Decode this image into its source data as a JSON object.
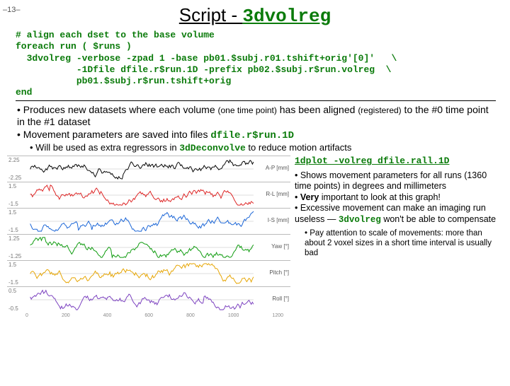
{
  "page_number": "–13–",
  "title": {
    "prefix": "Script - ",
    "cmd": "3dvolreg"
  },
  "code_block": "# align each dset to the base volume\nforeach run ( $runs )\n  3dvolreg -verbose -zpad 1 -base pb01.$subj.r01.tshift+orig'[0]'   \\\n           -1Dfile dfile.r$run.1D -prefix pb02.$subj.r$run.volreg  \\\n           pb01.$subj.r$run.tshift+orig\nend",
  "bullets": {
    "b1_a": "• Produces new datasets where each volume ",
    "b1_paren1": "(one time point)",
    "b1_b": " has been aligned ",
    "b1_paren2": "(registered)",
    "b1_c": " to the #0 time point in the #1 dataset",
    "b2": "• Movement parameters are saved into files ",
    "b2_code": "dfile.r$run.1D",
    "b3_a": "• Will be used as extra regressors in ",
    "b3_code": "3dDeconvolve",
    "b3_b": " to reduce motion artifacts"
  },
  "plot_cmd": "1dplot -volreg dfile.rall.1D",
  "side": {
    "s1": "• Shows movement parameters for all runs (1360 time points) in degrees and millimeters",
    "s2_a": "• ",
    "s2_bold": "Very",
    "s2_b": " important to look at this graph!",
    "s3_a": "• Excessive movement can make an imaging run useless — ",
    "s3_code": "3dvolreg",
    "s3_b": " won't be able to compensate",
    "s4": "• Pay attention to scale of movements: more than about 2 voxel sizes in a short time interval is usually bad"
  },
  "chart_data": [
    {
      "type": "line",
      "label": "A-P [mm]",
      "ylim": [
        -2.25,
        2.25
      ],
      "yticks": [
        "2.25",
        "-2.25"
      ],
      "color": "#000",
      "series": "noisy-flat"
    },
    {
      "type": "line",
      "label": "R-L [mm]",
      "ylim": [
        -1.5,
        1.5
      ],
      "yticks": [
        "1.5",
        "-1.5"
      ],
      "color": "#d22",
      "series": "noisy-flat"
    },
    {
      "type": "line",
      "label": "I-S [mm]",
      "ylim": [
        -1.5,
        1.5
      ],
      "yticks": [
        "1.5",
        "-1.5"
      ],
      "color": "#1763d6",
      "series": "noisy-flat"
    },
    {
      "type": "line",
      "label": "Yaw [°]",
      "ylim": [
        -1.25,
        1.25
      ],
      "yticks": [
        "1.25",
        "-1.25"
      ],
      "color": "#0a9a0a",
      "series": "noisy-flat"
    },
    {
      "type": "line",
      "label": "Pitch [°]",
      "ylim": [
        -1.5,
        1.5
      ],
      "yticks": [
        "1.5",
        "-1.5"
      ],
      "color": "#e6a400",
      "series": "noisy-flat"
    },
    {
      "type": "line",
      "label": "Roll [°]",
      "ylim": [
        -0.5,
        0.5
      ],
      "yticks": [
        "0.5",
        "-0.5"
      ],
      "color": "#7a3fbf",
      "series": "noisy-flat"
    }
  ],
  "xaxis": {
    "min": 0,
    "max": 1360,
    "ticks": [
      "0",
      "200",
      "400",
      "600",
      "800",
      "1000",
      "1200"
    ]
  }
}
